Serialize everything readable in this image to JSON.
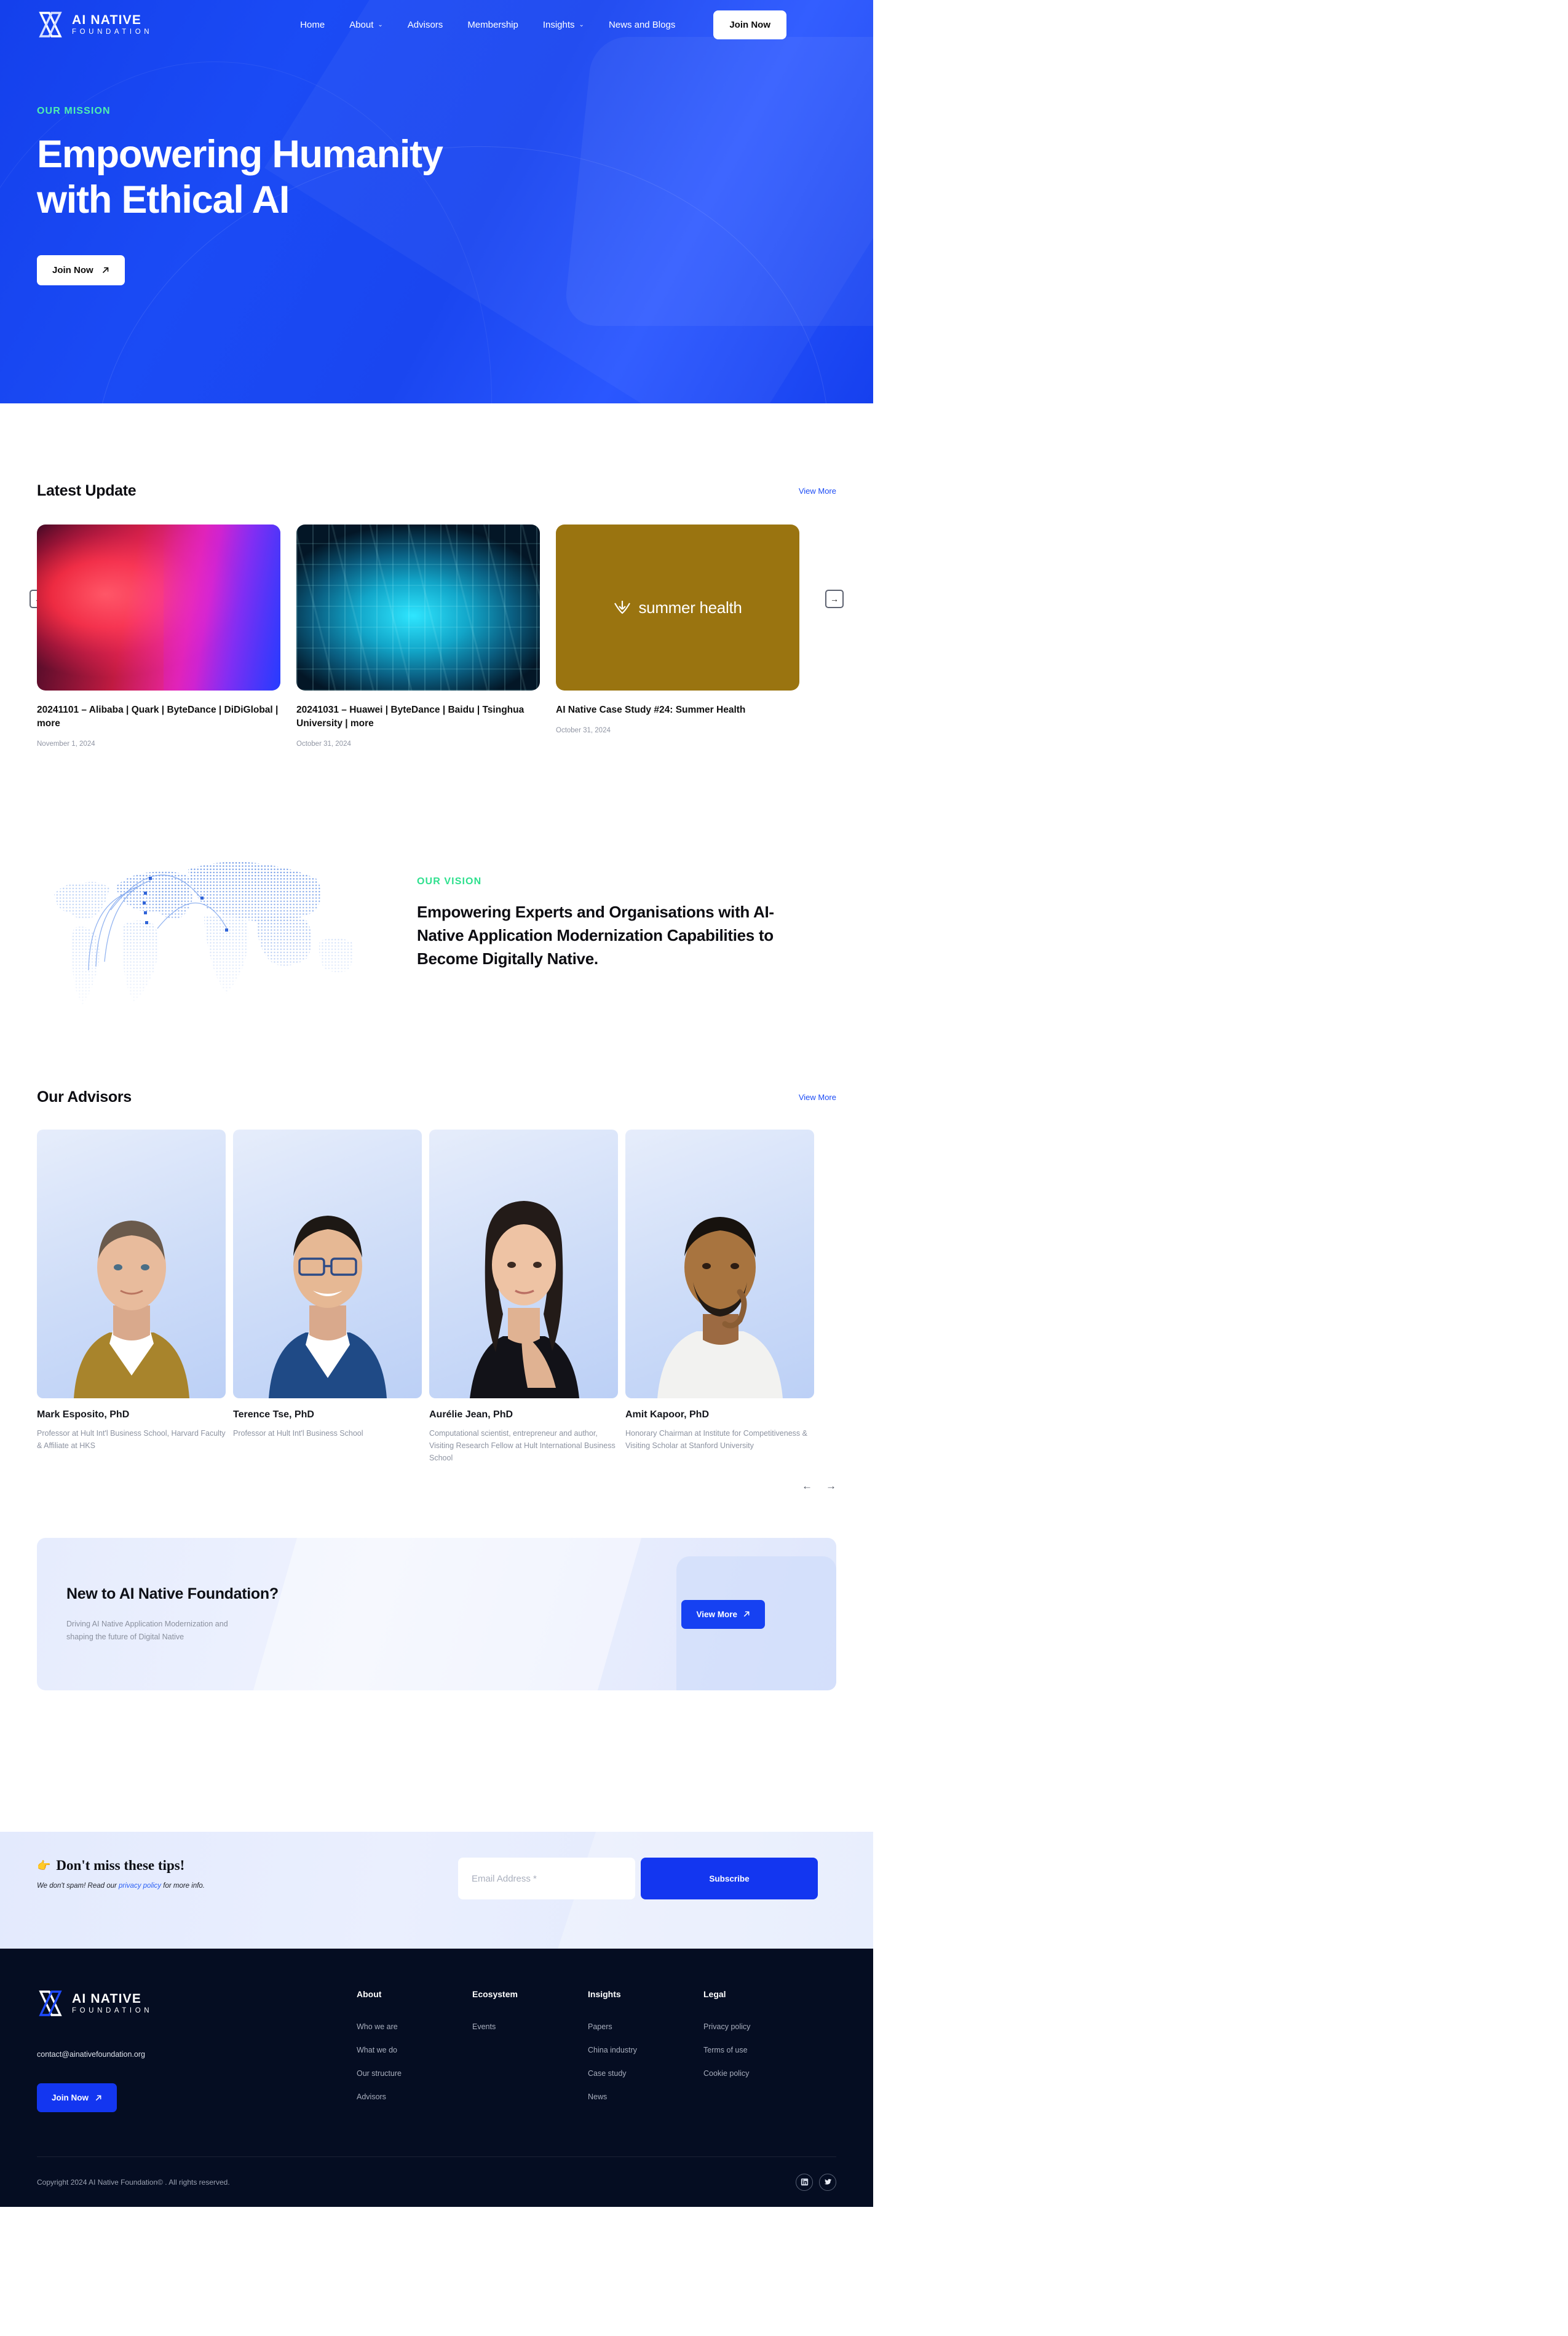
{
  "brand": {
    "line1": "AI NATIVE",
    "line2": "FOUNDATION",
    "logo_icon": "ai-native-infinity-logo"
  },
  "nav": {
    "items": [
      {
        "label": "Home",
        "has_caret": false
      },
      {
        "label": "About",
        "has_caret": true
      },
      {
        "label": "Advisors",
        "has_caret": false
      },
      {
        "label": "Membership",
        "has_caret": false
      },
      {
        "label": "Insights",
        "has_caret": true
      },
      {
        "label": "News and Blogs",
        "has_caret": false
      }
    ],
    "cta_label": "Join Now"
  },
  "hero": {
    "eyebrow": "OUR MISSION",
    "title_line1": "Empowering Humanity",
    "title_line2": "with Ethical AI",
    "button_label": "Join Now",
    "button_icon": "arrow-up-right-icon",
    "bg_color": "#1b4bf5",
    "eyebrow_color": "#4ff0b0"
  },
  "latest": {
    "title": "Latest Update",
    "view_more": "View More",
    "prev_icon": "arrow-left-icon",
    "next_icon": "arrow-right-icon",
    "cards": [
      {
        "title": "20241101 – Alibaba | Quark | ByteDance | DiDiGlobal | more",
        "date": "November 1, 2024",
        "image": "abstract-red-blue-ai-head"
      },
      {
        "title": "20241031 – Huawei | ByteDance | Baidu | Tsinghua University | more",
        "date": "October 31, 2024",
        "image": "cyan-circuit-board"
      },
      {
        "title": "AI Native Case Study #24: Summer Health",
        "date": "October 31, 2024",
        "image": "summer-health-logo-gold",
        "logo_text": "summer health"
      }
    ]
  },
  "vision": {
    "eyebrow": "OUR VISION",
    "title": "Empowering Experts and Organisations with AI-Native Application Modernization Capabilities to Become Digitally Native.",
    "image": "dotted-world-map-connections"
  },
  "advisors": {
    "title": "Our Advisors",
    "view_more": "View More",
    "prev_icon": "arrow-left-icon",
    "next_icon": "arrow-right-icon",
    "people": [
      {
        "name": "Mark Esposito, PhD",
        "role": "Professor at Hult Int'l Business School, Harvard Faculty & Affiliate at HKS",
        "photo": "portrait-tan-blazer"
      },
      {
        "name": "Terence Tse, PhD",
        "role": "Professor at Hult Int'l Business School",
        "photo": "portrait-glasses-navy-suit"
      },
      {
        "name": "Aurélie Jean, PhD",
        "role": "Computational scientist, entrepreneur and author, Visiting Research Fellow at Hult International Business School",
        "photo": "portrait-long-dark-hair"
      },
      {
        "name": "Amit Kapoor, PhD",
        "role": "Honorary Chairman at Institute for Competitiveness & Visiting Scholar at Stanford University",
        "photo": "portrait-white-shirt-beard"
      }
    ]
  },
  "cta": {
    "title": "New to AI Native Foundation?",
    "subtitle": "Driving AI Native Application Modernization and shaping the future of Digital Native",
    "button_label": "View More",
    "button_icon": "arrow-up-right-icon",
    "button_color": "#1641f2"
  },
  "newsletter": {
    "emoji": "👉",
    "title": "Don't miss these tips!",
    "sub_prefix": "We don't spam! Read our ",
    "sub_link": "privacy policy",
    "sub_suffix": " for more info.",
    "input_placeholder": "Email Address *",
    "input_value": "",
    "button_label": "Subscribe"
  },
  "footer": {
    "email": "contact@ainativefoundation.org",
    "join_label": "Join Now",
    "join_icon": "arrow-up-right-icon",
    "columns": [
      {
        "title": "About",
        "links": [
          "Who we are",
          "What we do",
          "Our structure",
          "Advisors"
        ]
      },
      {
        "title": "Ecosystem",
        "links": [
          "Events"
        ]
      },
      {
        "title": "Insights",
        "links": [
          "Papers",
          "China industry",
          "Case study",
          "News"
        ]
      },
      {
        "title": "Legal",
        "links": [
          "Privacy policy",
          "Terms of use",
          "Cookie policy"
        ]
      }
    ],
    "copyright": "Copyright 2024 AI Native Foundation© . All rights reserved.",
    "socials": [
      {
        "name": "linkedin-icon"
      },
      {
        "name": "twitter-icon"
      }
    ]
  }
}
